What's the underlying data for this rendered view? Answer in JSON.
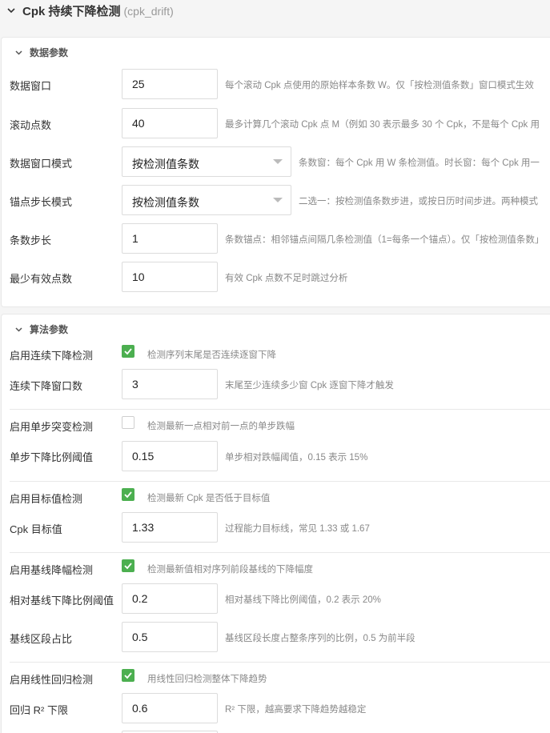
{
  "header": {
    "title": "Cpk 持续下降检测",
    "subtitle": "(cpk_drift)"
  },
  "data_params": {
    "heading": "数据参数",
    "rows": [
      {
        "label": "数据窗口",
        "value": "25",
        "hint": "每个滚动 Cpk 点使用的原始样本条数 W。仅「按检测值条数」窗口模式生效"
      },
      {
        "label": "滚动点数",
        "value": "40",
        "hint": "最多计算几个滚动 Cpk 点 M（例如 30 表示最多 30 个 Cpk，不是每个 Cpk 用"
      },
      {
        "label": "数据窗口模式",
        "value": "按检测值条数",
        "hint": "条数窗：每个 Cpk 用 W 条检测值。时长窗：每个 Cpk 用一"
      },
      {
        "label": "锚点步长模式",
        "value": "按检测值条数",
        "hint": "二选一：按检测值条数步进，或按日历时间步进。两种模式"
      },
      {
        "label": "条数步长",
        "value": "1",
        "hint": "条数锚点：相邻锚点间隔几条检测值（1=每条一个锚点）。仅「按检测值条数」"
      },
      {
        "label": "最少有效点数",
        "value": "10",
        "hint": "有效 Cpk 点数不足时跳过分析"
      }
    ]
  },
  "algo_params": {
    "heading": "算法参数",
    "groups": [
      {
        "toggle_label": "启用连续下降检测",
        "checked": true,
        "toggle_hint": "检测序列末尾是否连续逐窗下降",
        "fields": [
          {
            "label": "连续下降窗口数",
            "value": "3",
            "hint": "末尾至少连续多少窗 Cpk 逐窗下降才触发"
          }
        ]
      },
      {
        "toggle_label": "启用单步突变检测",
        "checked": false,
        "toggle_hint": "检测最新一点相对前一点的单步跌幅",
        "fields": [
          {
            "label": "单步下降比例阈值",
            "value": "0.15",
            "hint": "单步相对跌幅阈值，0.15 表示 15%"
          }
        ]
      },
      {
        "toggle_label": "启用目标值检测",
        "checked": true,
        "toggle_hint": "检测最新 Cpk 是否低于目标值",
        "fields": [
          {
            "label": "Cpk 目标值",
            "value": "1.33",
            "hint": "过程能力目标线，常见 1.33 或 1.67"
          }
        ]
      },
      {
        "toggle_label": "启用基线降幅检测",
        "checked": true,
        "toggle_hint": "检测最新值相对序列前段基线的下降幅度",
        "fields": [
          {
            "label": "相对基线下降比例阈值",
            "value": "0.2",
            "hint": "相对基线下降比例阈值，0.2 表示 20%"
          },
          {
            "label": "基线区段占比",
            "value": "0.5",
            "hint": "基线区段长度占整条序列的比例，0.5 为前半段"
          }
        ]
      },
      {
        "toggle_label": "启用线性回归检测",
        "checked": true,
        "toggle_hint": "用线性回归检测整体下降趋势",
        "fields": [
          {
            "label": "回归 R² 下限",
            "value": "0.6",
            "hint": "R² 下限，越高要求下降趋势越稳定"
          }
        ]
      }
    ]
  },
  "colors": {
    "accent_green": "#4caf50",
    "hint_gray": "#888888"
  },
  "icons": {
    "section_toggle": "chevron-down-icon",
    "checkbox_checked": "check-icon"
  }
}
